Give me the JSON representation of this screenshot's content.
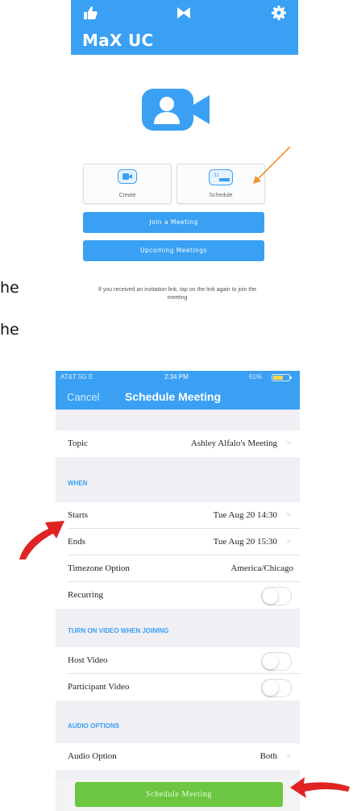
{
  "top_app": {
    "header_title": "MaX UC",
    "create_label": "Create",
    "schedule_label": "Schedule",
    "calendar_day": "31",
    "join_button": "Join a Meeting",
    "upcoming_button": "Upcoming Meetings",
    "invite_text": "If you received an invitation link, tap on the link again to join the meeting",
    "accent_color": "#3aa0f3"
  },
  "side_fragments": [
    "he",
    "he"
  ],
  "schedule": {
    "status_bar": {
      "carrier": "AT&T 5G E",
      "time": "2:34 PM",
      "battery": "61%"
    },
    "nav": {
      "cancel": "Cancel",
      "title": "Schedule Meeting"
    },
    "topic": {
      "label": "Topic",
      "value": "Ashley Alfalo's Meeting"
    },
    "when_header": "WHEN",
    "starts": {
      "label": "Starts",
      "value": "Tue Aug 20 14:30"
    },
    "ends": {
      "label": "Ends",
      "value": "Tue Aug 20 15:30"
    },
    "timezone": {
      "label": "Timezone Option",
      "value": "America/Chicago"
    },
    "recurring": {
      "label": "Recurring",
      "on": false
    },
    "video_header": "TURN ON VIDEO WHEN JOINING",
    "host_video": {
      "label": "Host Video",
      "on": false
    },
    "participant_video": {
      "label": "Participant Video",
      "on": false
    },
    "audio_header": "AUDIO OPTIONS",
    "audio_option": {
      "label": "Audio Option",
      "value": "Both"
    },
    "submit_button": "Schedule Meeting",
    "submit_color": "#6cc641"
  }
}
